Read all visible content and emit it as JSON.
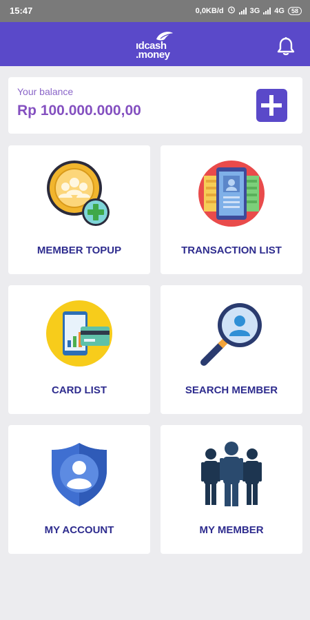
{
  "status_bar": {
    "time": "15:47",
    "net_speed": "0,0KB/d",
    "net_3g": "3G",
    "net_4g": "4G",
    "battery": "58"
  },
  "app_bar": {
    "logo_line1": "ıdcash",
    "logo_line2": ".money",
    "accent": "#5a49c9"
  },
  "balance": {
    "label": "Your balance",
    "value": "Rp 100.000.000,00"
  },
  "menu": {
    "member_topup": "MEMBER TOPUP",
    "transaction_list": "TRANSACTION LIST",
    "card_list": "CARD LIST",
    "search_member": "SEARCH MEMBER",
    "my_account": "MY ACCOUNT",
    "my_member": "MY MEMBER"
  },
  "icons": {
    "member_topup": "members-coin-plus-icon",
    "transaction_list": "transaction-list-icon",
    "card_list": "card-list-icon",
    "search_member": "search-member-icon",
    "my_account": "account-shield-icon",
    "my_member": "group-members-icon"
  }
}
